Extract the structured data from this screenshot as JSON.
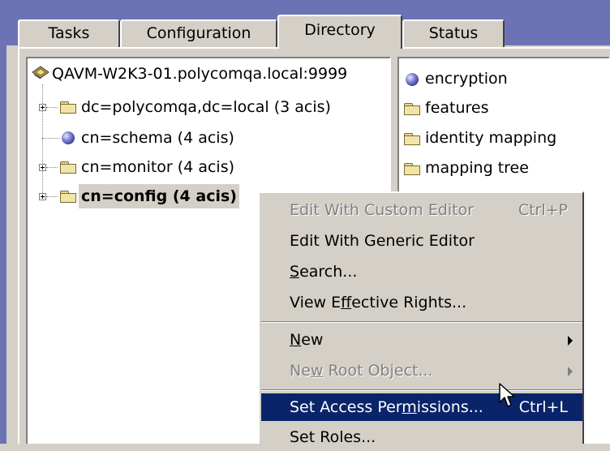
{
  "tabs": [
    {
      "label": "Tasks"
    },
    {
      "label": "Configuration"
    },
    {
      "label": "Directory"
    },
    {
      "label": "Status"
    }
  ],
  "tree": {
    "root": "QAVM-W2K3-01.polycomqa.local:9999",
    "items": [
      {
        "label": "dc=polycomqa,dc=local  (3 acis)"
      },
      {
        "label": "cn=schema  (4 acis)"
      },
      {
        "label": "cn=monitor  (4 acis)"
      },
      {
        "label": "cn=config  (4 acis)"
      }
    ]
  },
  "list": {
    "items": [
      {
        "label": "encryption",
        "icon": "globe-icon"
      },
      {
        "label": "features",
        "icon": "folder-icon"
      },
      {
        "label": "identity mapping",
        "icon": "folder-icon"
      },
      {
        "label": "mapping tree",
        "icon": "folder-icon"
      }
    ]
  },
  "context_menu": {
    "edit_custom": {
      "label": "Edit With Custom Editor",
      "shortcut": "Ctrl+P"
    },
    "edit_generic": {
      "label": "Edit With Generic Editor"
    },
    "search": {
      "pre": "",
      "u": "S",
      "post": "earch..."
    },
    "view_rights": {
      "pre": "View E",
      "u": "f",
      "post": "fective Rights..."
    },
    "new": {
      "pre": "",
      "u": "N",
      "post": "ew"
    },
    "new_root": {
      "pre": "Ne",
      "u": "w",
      "post": " Root Object..."
    },
    "set_access": {
      "pre": "Set Access Per",
      "u": "m",
      "post": "issions...",
      "shortcut": "Ctrl+L"
    },
    "set_roles": {
      "label": "Set Roles..."
    }
  },
  "colors": {
    "highlight": "#0a246a",
    "face": "#d4d0c8",
    "accent": "#6b73b5"
  }
}
